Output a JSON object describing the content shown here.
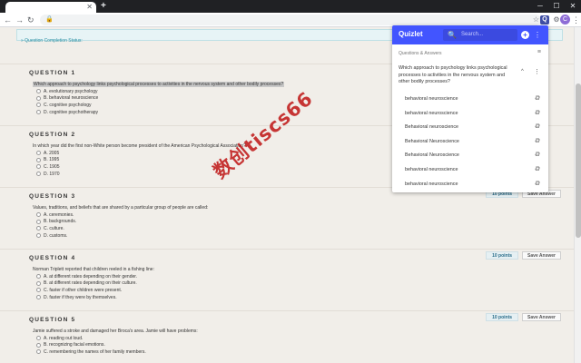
{
  "browser": {
    "close_glyph": "✕",
    "newtab_glyph": "+",
    "window": {
      "minimize": "─",
      "maximize": "☐",
      "close": "✕"
    },
    "back": "←",
    "forward": "→",
    "reload": "↻",
    "lock": "🔒",
    "star": "☆",
    "ext_label": "Q",
    "ext_other": "⚙",
    "avatar": "C",
    "menu": "⋮"
  },
  "page": {
    "completion_status": "» Question Completion Status:",
    "questions": [
      {
        "title": "QUESTION 1",
        "points": "",
        "save_label": "",
        "text": "Which approach to psychology links psychological processes to activities in the nervous system and other bodily processes?",
        "answers": [
          "A. evolutionary psychology",
          "B. behavioral neuroscience",
          "C. cognitive psychology",
          "D. cognitive psychotherapy"
        ]
      },
      {
        "title": "QUESTION 2",
        "points": "",
        "save_label": "",
        "text": "In which year did the first non-White person become president of the American Psychological Association?",
        "answers": [
          "A. 2005",
          "B. 1995",
          "C. 1905",
          "D. 1970"
        ]
      },
      {
        "title": "QUESTION 3",
        "points": "10 points",
        "save_label": "Save Answer",
        "text": "Values, traditions, and beliefs that are shared by a particular group of people are called:",
        "answers": [
          "A. ceremonies.",
          "B. backgrounds.",
          "C. culture.",
          "D. customs."
        ]
      },
      {
        "title": "QUESTION 4",
        "points": "10 points",
        "save_label": "Save Answer",
        "text": "Norman Triplett reported that children reeled in a fishing line:",
        "answers": [
          "A. at different rates depending on their gender.",
          "B. at different rates depending on their culture.",
          "C. faster if other children were present.",
          "D. faster if they were by themselves."
        ]
      },
      {
        "title": "QUESTION 5",
        "points": "10 points",
        "save_label": "Save Answer",
        "text": "Jamie suffered a stroke and damaged her Broca's area. Jamie will have problems:",
        "answers": [
          "A. reading out loud.",
          "B. recognizing facial emotions.",
          "C. remembering the names of her family members."
        ]
      }
    ]
  },
  "quizlet": {
    "brand": "Quizlet",
    "search_icon": "🔍",
    "search_placeholder": "Search...",
    "add": "+",
    "more": "⋮",
    "section_label": "Questions & Answers",
    "sort_icon": "≡",
    "question": "Which approach to psychology links psychological processes to activities in the nervous system and other bodily processes?",
    "collapse": "^",
    "copy_glyph": "⧉",
    "answers": [
      "behavioral neuroscience",
      "behavioral neuroscience",
      "Behavioral neuroscience",
      "Behavioral Neuroscience",
      "Behavioral Neuroscience",
      "behavioral neuroscience",
      "behavioral neuroscience"
    ]
  },
  "watermark": "数创tiscs66"
}
